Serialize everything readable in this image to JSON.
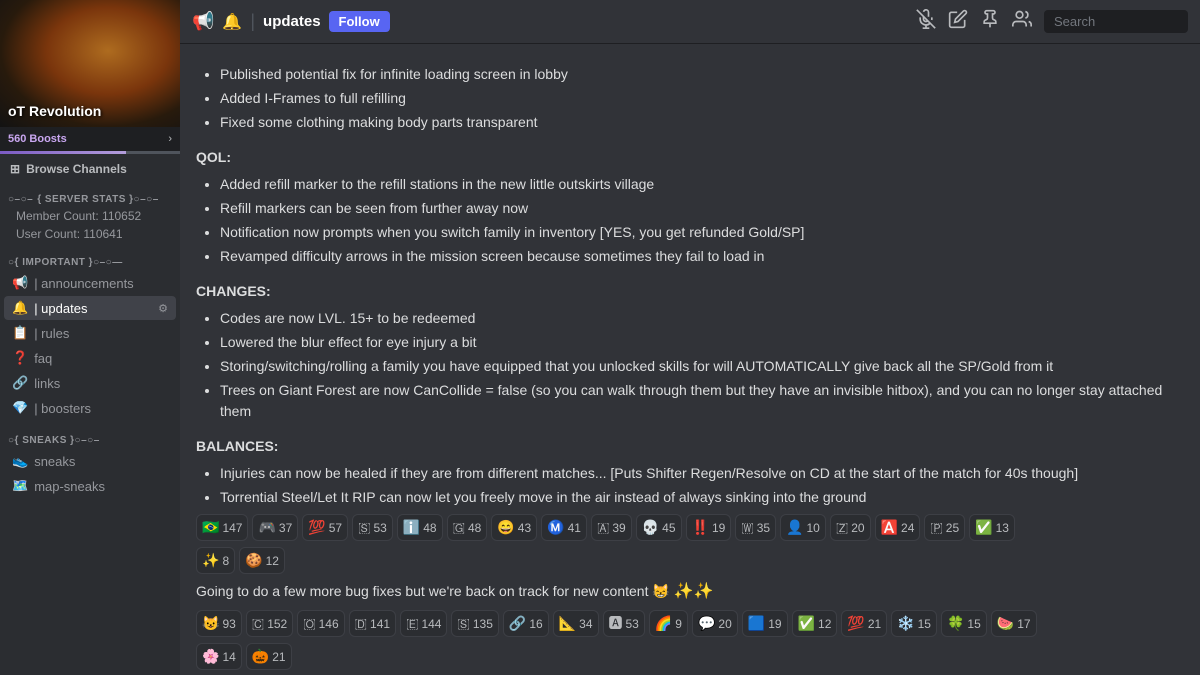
{
  "server": {
    "name": "oT Revolution",
    "boosts": "560 Boosts",
    "boost_arrow": "›"
  },
  "sidebar": {
    "browse_label": "Browse Channels",
    "sections": [
      {
        "name": "SERVER STATS",
        "id": "server-stats",
        "prefix": "○–○–",
        "items": [],
        "stats": [
          "Member Count: 110652",
          "User Count: 110641"
        ]
      },
      {
        "name": "IMPORTANT",
        "id": "important",
        "prefix": "○–○—",
        "items": [
          {
            "id": "announcements",
            "label": "| announcements",
            "icon": "📢",
            "active": false
          },
          {
            "id": "updates",
            "label": "| updates",
            "icon": "🔔",
            "active": true,
            "has_admin": true
          },
          {
            "id": "rules",
            "label": "| rules",
            "icon": "📋",
            "active": false
          },
          {
            "id": "faq",
            "label": "faq",
            "icon": "❓",
            "active": false
          },
          {
            "id": "links",
            "label": "links",
            "icon": "🔗",
            "active": false
          },
          {
            "id": "boosters",
            "label": "| boosters",
            "icon": "💎",
            "active": false
          }
        ]
      },
      {
        "name": "SNEAKS",
        "id": "sneaks",
        "prefix": "○–○–",
        "items": [
          {
            "id": "sneaks",
            "label": "sneaks",
            "icon": "👟",
            "active": false
          },
          {
            "id": "map-sneaks",
            "label": "map-sneaks",
            "icon": "🗺️",
            "active": false
          }
        ]
      }
    ]
  },
  "topbar": {
    "channel_name": "updates",
    "follow_label": "Follow",
    "search_placeholder": "Search",
    "icons": {
      "mute": "🔕",
      "edit": "✏️",
      "pin": "📌",
      "members": "👥"
    }
  },
  "content": {
    "bullet_items_top": [
      "Published potential fix for infinite loading screen in lobby",
      "Added I-Frames to full refilling",
      "Fixed some clothing making body parts transparent"
    ],
    "qol_header": "QOL:",
    "qol_items": [
      "Added refill marker to the refill stations in the new little outskirts village",
      "Refill markers can be seen from further away now",
      "Notification now prompts when you switch family in inventory [YES, you get refunded Gold/SP]",
      "Revamped difficulty arrows in the mission screen because sometimes they fail to load in"
    ],
    "changes_header": "CHANGES:",
    "changes_items": [
      "Codes are now LVL. 15+ to be redeemed",
      "Lowered the blur effect for eye injury a bit",
      "Storing/switching/rolling a family you have equipped that you unlocked skills for will AUTOMATICALLY give back all the SP/Gold from it",
      "Trees on Giant Forest are now CanCollide = false (so you can walk through them but they have an invisible hitbox), and you can no longer stay attached them"
    ],
    "balances_header": "BALANCES:",
    "balances_items": [
      "Injuries can now be healed if they are from different matches... [Puts Shifter Regen/Resolve on CD at the start of the match for 40s though]",
      "Torrential Steel/Let It RIP can now let you freely move in the air instead of always sinking into the ground"
    ],
    "reactions_row1": [
      {
        "emoji": "🇧🇷",
        "count": "147"
      },
      {
        "emoji": "🎮",
        "count": "37"
      },
      {
        "emoji": "💯",
        "count": "57"
      },
      {
        "emoji": "🇸",
        "count": "53"
      },
      {
        "emoji": "ℹ️",
        "count": "48"
      },
      {
        "emoji": "🇬",
        "count": "48"
      },
      {
        "emoji": "😄",
        "count": "43"
      },
      {
        "emoji": "Ⓜ️",
        "count": "41"
      },
      {
        "emoji": "🇦",
        "count": "39"
      },
      {
        "emoji": "💀",
        "count": "45"
      },
      {
        "emoji": "❗❗",
        "count": "19"
      },
      {
        "emoji": "🇼",
        "count": "35"
      },
      {
        "emoji": "👤",
        "count": "10"
      },
      {
        "emoji": "🇿",
        "count": "20"
      },
      {
        "emoji": "🅰️",
        "count": "24"
      },
      {
        "emoji": "🇵",
        "count": "25"
      },
      {
        "emoji": "✅",
        "count": "13"
      }
    ],
    "reactions_row2": [
      {
        "emoji": "🌟",
        "count": "8"
      },
      {
        "emoji": "🍪",
        "count": "12"
      }
    ],
    "message_ending": "Going to do a few more bug fixes but we're back on track for new content 😸",
    "reactions_row3": [
      {
        "emoji": "😺",
        "count": "93"
      },
      {
        "emoji": "🇨",
        "count": "152"
      },
      {
        "emoji": "🇴",
        "count": "146"
      },
      {
        "emoji": "🇩",
        "count": "141"
      },
      {
        "emoji": "🇪",
        "count": "144"
      },
      {
        "emoji": "🇸",
        "count": "135"
      },
      {
        "emoji": "🔗",
        "count": "16"
      },
      {
        "emoji": "📐",
        "count": "34"
      },
      {
        "emoji": "🅰",
        "count": "53"
      },
      {
        "emoji": "🌈",
        "count": "9"
      },
      {
        "emoji": "💬",
        "count": "20"
      },
      {
        "emoji": "🟦",
        "count": "19"
      },
      {
        "emoji": "✅",
        "count": "12"
      },
      {
        "emoji": "💯",
        "count": "21"
      },
      {
        "emoji": "❄️",
        "count": "15"
      },
      {
        "emoji": "🍀",
        "count": "15"
      },
      {
        "emoji": "🍉",
        "count": "17"
      }
    ],
    "reactions_row4": [
      {
        "emoji": "🌸",
        "count": "14"
      },
      {
        "emoji": "🎃",
        "count": "21"
      }
    ]
  }
}
